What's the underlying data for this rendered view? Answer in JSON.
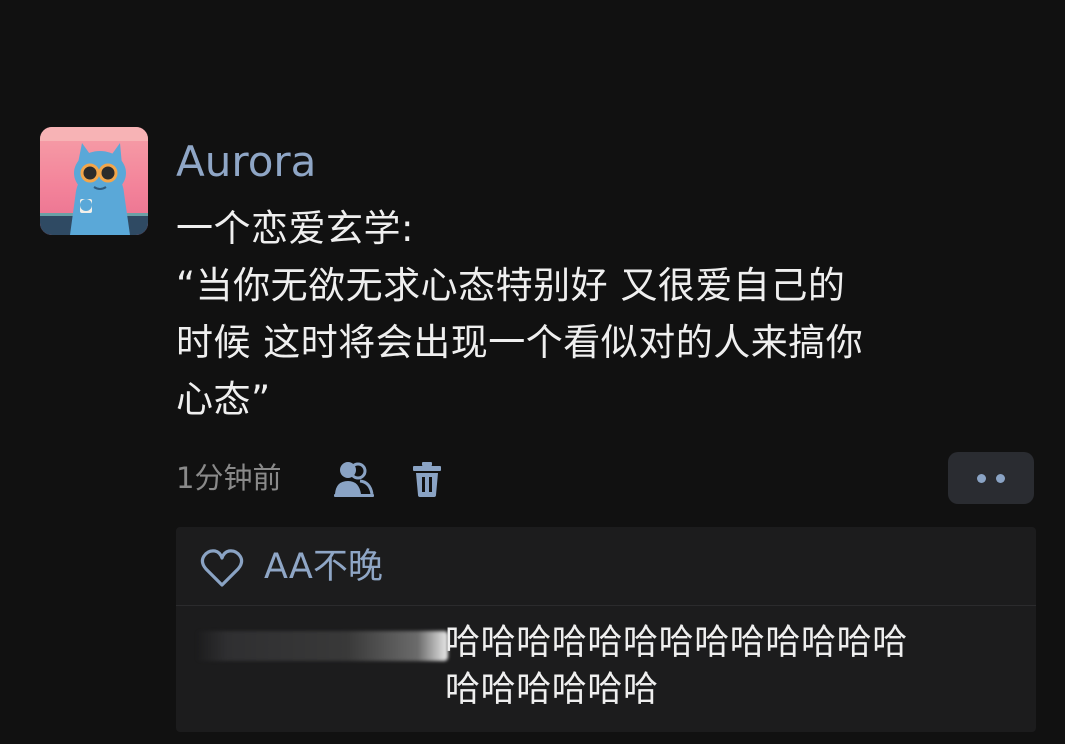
{
  "post": {
    "author": "Aurora",
    "content_lines": [
      "一个恋爱玄学:",
      "“当你无欲无求心态特别好 又很爱自己的",
      "时候 这时将会出现一个看似对的人来搞你",
      "心态”"
    ],
    "timestamp": "1分钟前",
    "icons": {
      "author_avatar": "cat-avatar",
      "visibility": "user-icon",
      "delete": "trash-icon",
      "more": "more-dots-icon",
      "like": "heart-icon"
    }
  },
  "likes": {
    "names": "AA不晚"
  },
  "comments": [
    {
      "author": "",
      "text_lines": [
        "哈哈哈哈哈哈哈哈哈哈哈哈哈",
        "哈哈哈哈哈哈"
      ]
    }
  ],
  "colors": {
    "background": "#111111",
    "name_accent": "#8fa6c6",
    "text": "#efefef",
    "muted": "#8a8a8a",
    "comment_bg": "#1c1c1d"
  }
}
